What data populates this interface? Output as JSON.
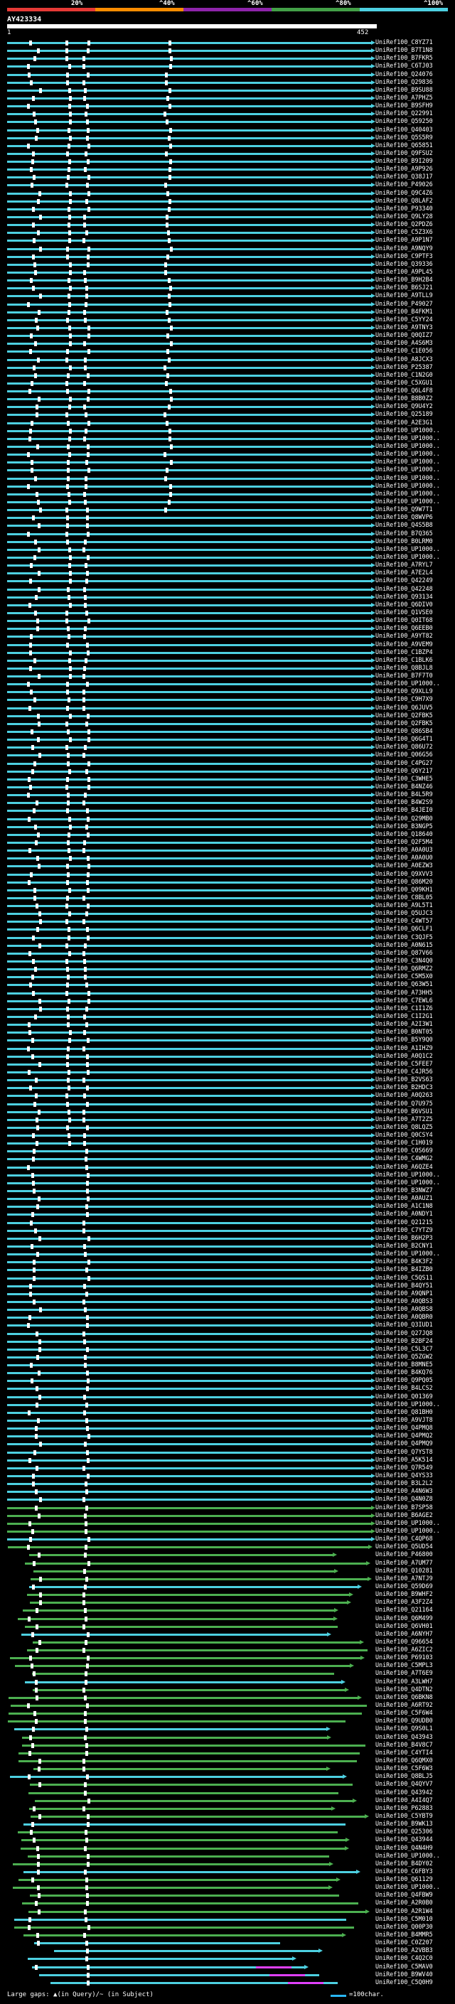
{
  "legend": {
    "labels": [
      "20%",
      "^40%",
      "^60%",
      "^80%",
      "^100%"
    ],
    "colors": [
      "#e53935",
      "#fb8c00",
      "#8e24aa",
      "#43a047",
      "#4dd0e1"
    ]
  },
  "query": {
    "name": "AY423334",
    "start": "1",
    "end": "452"
  },
  "colors": {
    "cyan": "#4dd0e1",
    "green": "#4caf50",
    "magenta": "#e040fb",
    "gap": "#ffffff",
    "background": "#000000"
  },
  "rows": [
    "UniRef100_C8YZ71",
    "UniRef100_B7T1N8",
    "UniRef100_B7FKR5",
    "UniRef100_C6TJ03",
    "UniRef100_Q24076",
    "UniRef100_Q29836",
    "UniRef100_B9SU88",
    "UniRef100_A7PHZ5",
    "UniRef100_B9SFH9",
    "UniRef100_Q22991",
    "UniRef100_Q59250",
    "UniRef100_Q40403",
    "UniRef100_Q5S5R9",
    "UniRef100_Q65851",
    "UniRef100_Q9FSU2",
    "UniRef100_B9I209",
    "UniRef100_A9P926",
    "UniRef100_Q38J17",
    "UniRef100_P49026",
    "UniRef100_Q9C4Z6",
    "UniRef100_Q8LAF2",
    "UniRef100_P93340",
    "UniRef100_Q9LY28",
    "UniRef100_Q2PDZ6",
    "UniRef100_C5Z3X6",
    "UniRef100_A9P1N7",
    "UniRef100_A9NQY9",
    "UniRef100_C9PTF3",
    "UniRef100_Q39336",
    "UniRef100_A9PL45",
    "UniRef100_B9H2B4",
    "UniRef100_B6SJ21",
    "UniRef100_A9TLL9",
    "UniRef100_P49027",
    "UniRef100_B4FKM1",
    "UniRef100_C5YY24",
    "UniRef100_A9TNY3",
    "UniRef100_Q0QIZ7",
    "UniRef100_A4S6M3",
    "UniRef100_C1E056",
    "UniRef100_A8JCX3",
    "UniRef100_P25387",
    "UniRef100_C1N2G0",
    "UniRef100_C5XGU1",
    "UniRef100_Q6L4F8",
    "UniRef100_B8B0Z2",
    "UniRef100_Q9U4Y2",
    "UniRef100_Q25189",
    "UniRef100_A2E3G1",
    "UniRef100_UP1000..",
    "UniRef100_UP1000..",
    "UniRef100_UP1000..",
    "UniRef100_UP1000..",
    "UniRef100_UP1000..",
    "UniRef100_UP1000..",
    "UniRef100_UP1000..",
    "UniRef100_UP1000..",
    "UniRef100_UP1000..",
    "UniRef100_UP1000..",
    "UniRef100_Q9W7T1",
    "UniRef100_Q8WVP6",
    "UniRef100_Q4S5B8",
    "UniRef100_B7Q365",
    "UniRef100_B0LRM0",
    "UniRef100_UP1000..",
    "UniRef100_UP1000..",
    "UniRef100_A7RYL7",
    "UniRef100_A7E2L4",
    "UniRef100_Q42249",
    "UniRef100_Q42248",
    "UniRef100_Q93134",
    "UniRef100_Q6DIV0",
    "UniRef100_Q1VSE0",
    "UniRef100_Q0IT68",
    "UniRef100_Q6EEB0",
    "UniRef100_A9YT82",
    "UniRef100_A9VEM9",
    "UniRef100_C1BZP4",
    "UniRef100_C1BLK6",
    "UniRef100_Q8BJL8",
    "UniRef100_B7F7T0",
    "UniRef100_UP1000..",
    "UniRef100_Q9XLL9",
    "UniRef100_C9H7X9",
    "UniRef100_Q6JUV5",
    "UniRef100_Q2FBK5",
    "UniRef100_Q2FBK5",
    "UniRef100_Q86SB4",
    "UniRef100_Q6G4T1",
    "UniRef100_Q86U72",
    "UniRef100_Q06G56",
    "UniRef100_C4PG27",
    "UniRef100_Q6Y217",
    "UniRef100_C3WHE5",
    "UniRef100_B4NZ46",
    "UniRef100_B4L5R9",
    "UniRef100_B4W2S9",
    "UniRef100_B4JEI0",
    "UniRef100_Q29MB0",
    "UniRef100_B3NGP5",
    "UniRef100_Q18640",
    "UniRef100_Q2F5M4",
    "UniRef100_A0A0U3",
    "UniRef100_A0A0U0",
    "UniRef100_A0EZW3",
    "UniRef100_Q9XVV3",
    "UniRef100_Q86M20",
    "UniRef100_Q09KH1",
    "UniRef100_C8BL05",
    "UniRef100_A9L5T1",
    "UniRef100_Q5UJC3",
    "UniRef100_C4WT57",
    "UniRef100_Q6CLF1",
    "UniRef100_C3QJF5",
    "UniRef100_A0N615",
    "UniRef100_Q87V66",
    "UniRef100_C3N4Q0",
    "UniRef100_Q6RMZ2",
    "UniRef100_C5M5X0",
    "UniRef100_Q63W51",
    "UniRef100_A73HH5",
    "UniRef100_C7EWL6",
    "UniRef100_C1I1Z6",
    "UniRef100_C1I2G1",
    "UniRef100_A2I3W1",
    "UniRef100_B0NT05",
    "UniRef100_B5Y9Q0",
    "UniRef100_A1IHZ9",
    "UniRef100_A0Q1C2",
    "UniRef100_C5FEE7",
    "UniRef100_C4JR56",
    "UniRef100_B2VS63",
    "UniRef100_B2HDC3",
    "UniRef100_A0Q263",
    "UniRef100_Q7U975",
    "UniRef100_B6VSU1",
    "UniRef100_A7T2Z5",
    "UniRef100_Q8LQZ5",
    "UniRef100_Q0CSY4",
    "UniRef100_C1H019",
    "UniRef100_C0S669",
    "UniRef100_C4WMG2",
    "UniRef100_A6QZE4",
    "UniRef100_UP1000..",
    "UniRef100_UP1000..",
    "UniRef100_B3NWZ7",
    "UniRef100_A0AUZ1",
    "UniRef100_A1C1N8",
    "UniRef100_A0NDY1",
    "UniRef100_Q21215",
    "UniRef100_C7YTZ9",
    "UniRef100_B6H2P3",
    "UniRef100_B2CNY1",
    "UniRef100_UP1000..",
    "UniRef100_B4K3F2",
    "UniRef100_B4IZB0",
    "UniRef100_C5QS11",
    "UniRef100_B4QY51",
    "UniRef100_A9QNP1",
    "UniRef100_A0QBS3",
    "UniRef100_A0QBS8",
    "UniRef100_A0QBR0",
    "UniRef100_Q3IUD1",
    "UniRef100_Q27JQ8",
    "UniRef100_B2BF24",
    "UniRef100_C5L3C7",
    "UniRef100_Q5ZGW2",
    "UniRef100_B8MNE5",
    "UniRef100_B4KQ76",
    "UniRef100_Q9PQ05",
    "UniRef100_B4LCS2",
    "UniRef100_Q01369",
    "UniRef100_UP1000..",
    "UniRef100_Q81BH0",
    "UniRef100_A9VJT8",
    "UniRef100_Q4PMQ8",
    "UniRef100_Q4PMQ2",
    "UniRef100_Q4PMQ9",
    "UniRef100_Q7YST8",
    "UniRef100_A5K514",
    "UniRef100_Q7R549",
    "UniRef100_Q4YS33",
    "UniRef100_B3L2L2",
    "UniRef100_A4N6W3",
    "UniRef100_Q4N0Z8",
    "UniRef100_B7SP58",
    "UniRef100_B6AGE2",
    "UniRef100_UP1000..",
    "UniRef100_UP1000..",
    "UniRef100_C4QP68",
    "UniRef100_Q5UD54",
    "UniRef100_P46800",
    "UniRef100_A7UM77",
    "UniRef100_Q10281",
    "UniRef100_A7NTJ9",
    "UniRef100_Q59D69",
    "UniRef100_B9WHF2",
    "UniRef100_A3F2Z4",
    "UniRef100_Q21164",
    "UniRef100_Q6M499",
    "UniRef100_Q6VH01",
    "UniRef100_A6NYH7",
    "UniRef100_Q96654",
    "UniRef100_A6ZIC2",
    "UniRef100_P69103",
    "UniRef100_C5MPL3",
    "UniRef100_A7T6E9",
    "UniRef100_A3LWH7",
    "UniRef100_Q4DTN2",
    "UniRef100_Q6BKN8",
    "UniRef100_A6RT92",
    "UniRef100_C5F6W4",
    "UniRef100_Q9UDB0",
    "UniRef100_Q9S0L1",
    "UniRef100_Q43943",
    "UniRef100_B4V8C7",
    "UniRef100_C4YTI4",
    "UniRef100_Q6QMX0",
    "UniRef100_C5F6W3",
    "UniRef100_Q8BLJ5",
    "UniRef100_Q4QYV7",
    "UniRef100_Q43942",
    "UniRef100_A4I4Q7",
    "UniRef100_P62883",
    "UniRef100_C5YBT9",
    "UniRef100_B9WK13",
    "UniRef100_Q25306",
    "UniRef100_Q43944",
    "UniRef100_Q4N4H9",
    "UniRef100_UP1000..",
    "UniRef100_B4DY02",
    "UniRef100_C6FBY3",
    "UniRef100_Q61129",
    "UniRef100_UP1000..",
    "UniRef100_Q4FBW9",
    "UniRef100_A2R0B0",
    "UniRef100_A2R1W4",
    "UniRef100_C5M010",
    "UniRef100_Q00P30",
    "UniRef100_B4MMR5",
    "UniRef100_C0Z207",
    "UniRef100_A2VBB3",
    "UniRef100_C4Q2C0",
    "UniRef100_C5MAV0",
    "UniRef100_B9WV40",
    "UniRef100_C5Q0H9"
  ],
  "footer": {
    "gaps_label": "Large gaps: ▲(in Query)/~ (in Subject)",
    "scale_label": "=100char."
  }
}
